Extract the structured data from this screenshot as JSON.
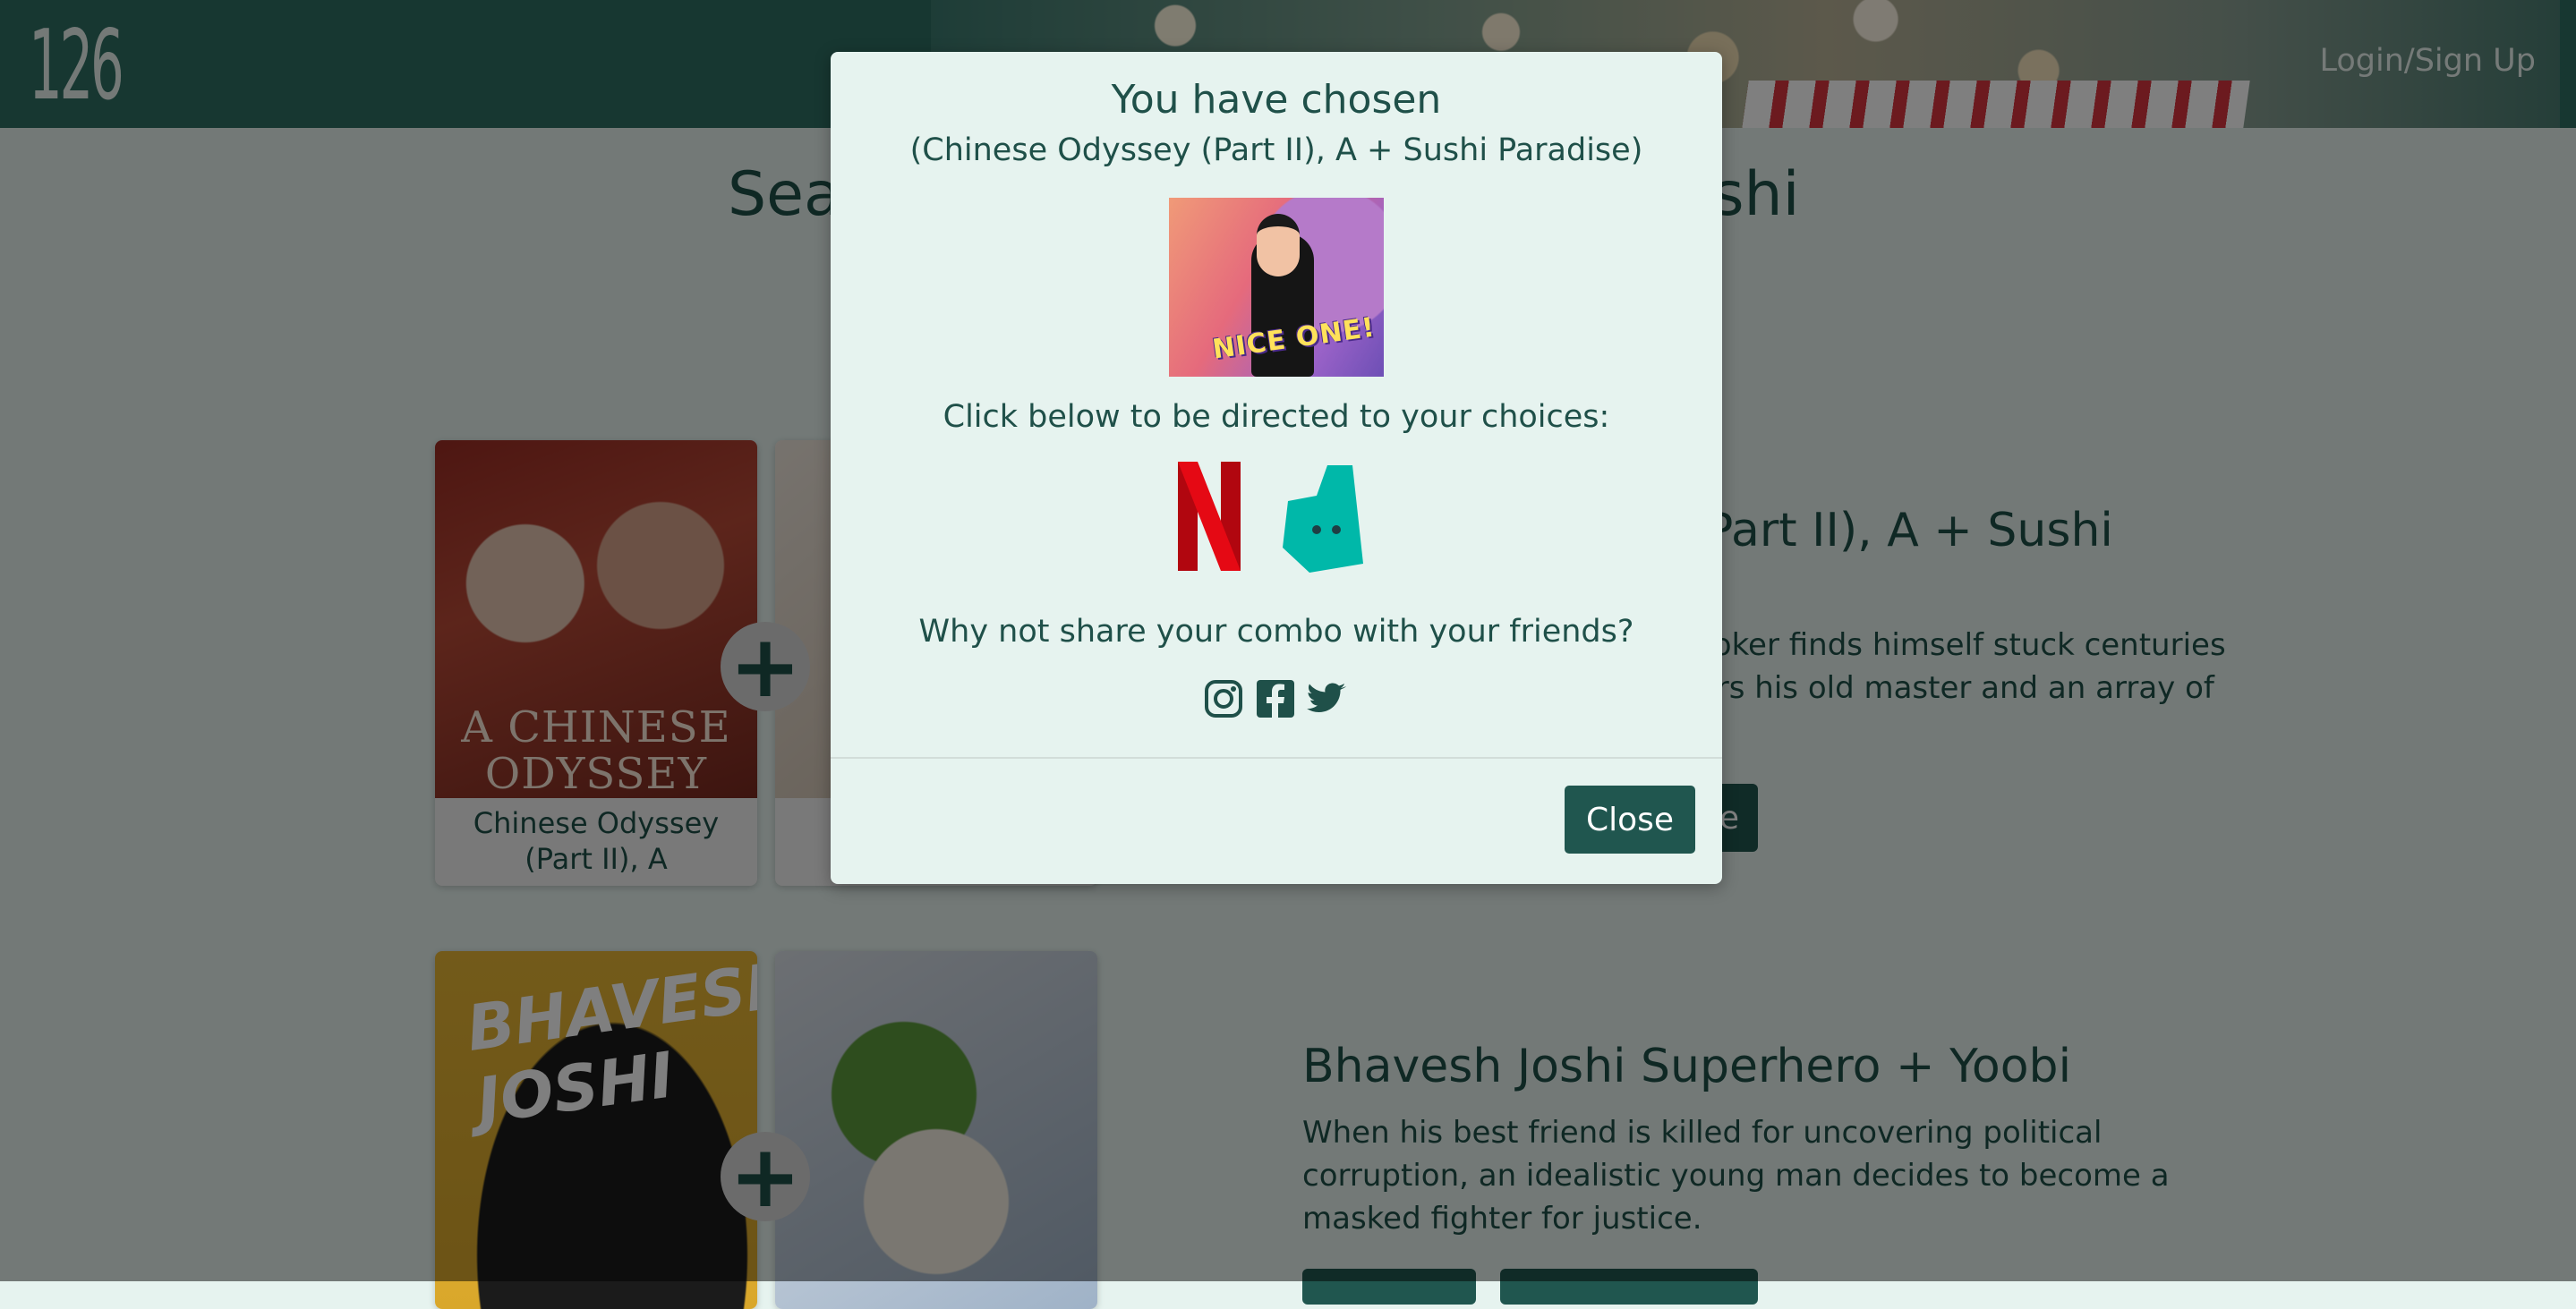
{
  "header": {
    "logo": "126",
    "login_label": "Login/Sign Up"
  },
  "page": {
    "title": "Sea",
    "title_tail": "ushi"
  },
  "combos": [
    {
      "movie_caption": "Chinese Odyssey (Part II), A",
      "poster_text": "A CHINESE ODYSSEY",
      "title_fragment": "Part II), A + Sushi",
      "desc_lines": [
        "x, Joker finds himself stuck centuries",
        "nters his old master and an array of"
      ],
      "button_fragment": "e"
    },
    {
      "poster_text": "BHAVESH JOSHI",
      "title": "Bhavesh Joshi Superhero + Yoobi",
      "desc": "When his best friend is killed for uncovering political corruption, an idealistic young man decides to become a masked fighter for justice."
    }
  ],
  "plus_glyph": "+",
  "modal": {
    "title": "You have chosen",
    "choice": "(Chinese Odyssey (Part II), A + Sushi Paradise)",
    "gif_text": "NICE ONE!",
    "directed_text": "Click below to be directed to your choices:",
    "netflix_label": "N",
    "share_text": "Why not share your combo with your friends?",
    "close_label": "Close"
  },
  "colors": {
    "accent": "#20564f",
    "header_bg": "#2f6f63",
    "netflix_red": "#e50914",
    "deliveroo_teal": "#00ccbc"
  }
}
